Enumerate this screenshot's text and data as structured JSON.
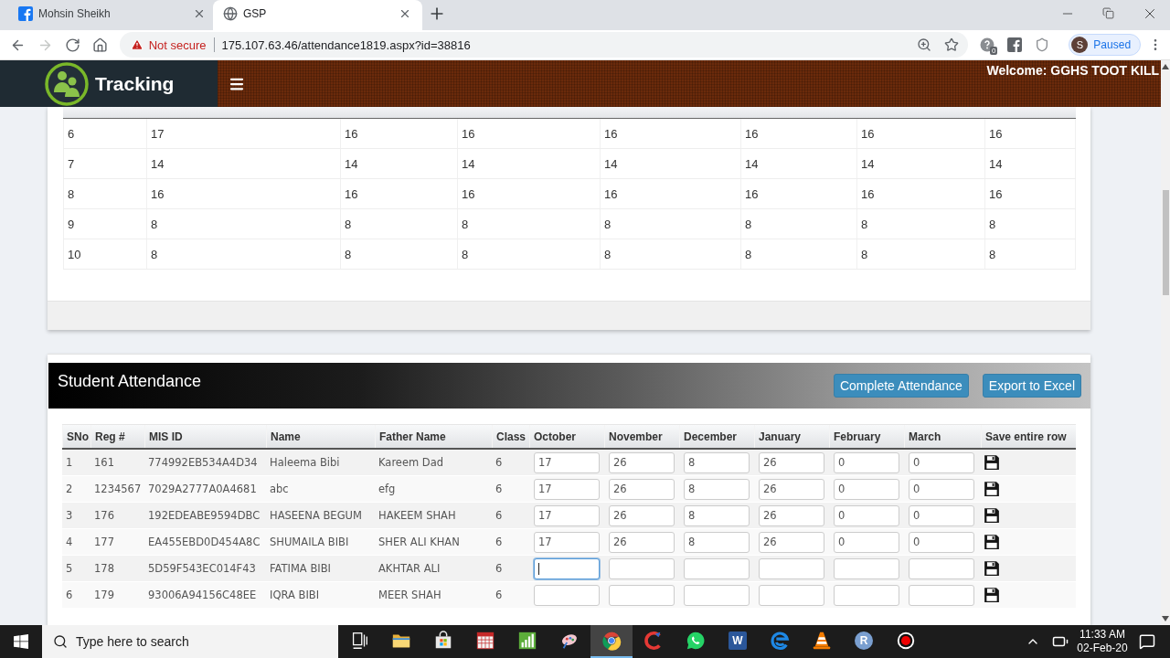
{
  "browser": {
    "tabs": [
      {
        "kind": "facebook",
        "title": "Mohsin Sheikh",
        "selected": false
      },
      {
        "kind": "globe",
        "title": "GSP",
        "selected": true
      }
    ],
    "nav": [
      {
        "kind": "back",
        "disabled": false
      },
      {
        "kind": "forward",
        "disabled": true
      },
      {
        "kind": "reload",
        "disabled": false
      },
      {
        "kind": "home",
        "disabled": false
      }
    ],
    "address_bar": {
      "security": "Not secure",
      "url": "175.107.63.46/attendance1819.aspx?id=38816"
    },
    "extensions": [
      {
        "kind": "badge",
        "badge": "0"
      },
      {
        "kind": "facebook"
      },
      {
        "kind": "shield"
      }
    ],
    "profile": {
      "initial": "S",
      "status": "Paused"
    }
  },
  "app_header": {
    "brand": "Tracking",
    "welcome": "Welcome: GGHS TOOT KILL"
  },
  "class_summary": {
    "rows": [
      [
        "6",
        "17",
        "16",
        "16",
        "16",
        "16",
        "16",
        "16"
      ],
      [
        "7",
        "14",
        "14",
        "14",
        "14",
        "14",
        "14",
        "14"
      ],
      [
        "8",
        "16",
        "16",
        "16",
        "16",
        "16",
        "16",
        "16"
      ],
      [
        "9",
        "8",
        "8",
        "8",
        "8",
        "8",
        "8",
        "8"
      ],
      [
        "10",
        "8",
        "8",
        "8",
        "8",
        "8",
        "8",
        "8"
      ]
    ]
  },
  "student_attendance": {
    "title": "Student Attendance",
    "buttons": [
      "Complete Attendance",
      "Export to Excel"
    ],
    "columns": [
      "SNo",
      "Reg #",
      "MIS ID",
      "Name",
      "Father Name",
      "Class",
      "October",
      "November",
      "December",
      "January",
      "February",
      "March",
      "Save entire row"
    ],
    "rows": [
      {
        "sno": "1",
        "reg": "161",
        "mis_id": "774992EB534A4D34",
        "name": "Haleema Bibi",
        "father_name": "Kareem Dad",
        "class": "6",
        "months": [
          {
            "value": "17",
            "focused": false
          },
          {
            "value": "26",
            "focused": false
          },
          {
            "value": "8",
            "focused": false
          },
          {
            "value": "26",
            "focused": false
          },
          {
            "value": "0",
            "focused": false
          },
          {
            "value": "0",
            "focused": false
          }
        ]
      },
      {
        "sno": "2",
        "reg": "1234567",
        "mis_id": "7029A2777A0A4681",
        "name": "abc",
        "father_name": "efg",
        "class": "6",
        "months": [
          {
            "value": "17",
            "focused": false
          },
          {
            "value": "26",
            "focused": false
          },
          {
            "value": "8",
            "focused": false
          },
          {
            "value": "26",
            "focused": false
          },
          {
            "value": "0",
            "focused": false
          },
          {
            "value": "0",
            "focused": false
          }
        ]
      },
      {
        "sno": "3",
        "reg": "176",
        "mis_id": "192EDEABE9594DBC",
        "name": "HASEENA BEGUM",
        "father_name": "HAKEEM SHAH",
        "class": "6",
        "months": [
          {
            "value": "17",
            "focused": false
          },
          {
            "value": "26",
            "focused": false
          },
          {
            "value": "8",
            "focused": false
          },
          {
            "value": "26",
            "focused": false
          },
          {
            "value": "0",
            "focused": false
          },
          {
            "value": "0",
            "focused": false
          }
        ]
      },
      {
        "sno": "4",
        "reg": "177",
        "mis_id": "EA455EBD0D454A8C",
        "name": "SHUMAILA BIBI",
        "father_name": "SHER ALI KHAN",
        "class": "6",
        "months": [
          {
            "value": "17",
            "focused": false
          },
          {
            "value": "26",
            "focused": false
          },
          {
            "value": "8",
            "focused": false
          },
          {
            "value": "26",
            "focused": false
          },
          {
            "value": "0",
            "focused": false
          },
          {
            "value": "0",
            "focused": false
          }
        ]
      },
      {
        "sno": "5",
        "reg": "178",
        "mis_id": "5D59F543EC014F43",
        "name": "FATIMA BIBI",
        "father_name": "AKHTAR ALI",
        "class": "6",
        "months": [
          {
            "focused": true
          },
          {
            "focused": false
          },
          {
            "focused": false
          },
          {
            "focused": false
          },
          {
            "focused": false
          },
          {
            "focused": false
          }
        ]
      },
      {
        "sno": "6",
        "reg": "179",
        "mis_id": "93006A94156C48EE",
        "name": "IQRA BIBI",
        "father_name": "MEER SHAH",
        "class": "6",
        "months": [
          {
            "focused": false
          },
          {
            "focused": false
          },
          {
            "focused": false
          },
          {
            "focused": false
          },
          {
            "focused": false
          },
          {
            "focused": false
          }
        ]
      }
    ]
  },
  "taskbar": {
    "search_placeholder": "Type here to search",
    "apps": [
      {
        "kind": "task-view",
        "selected": false
      },
      {
        "kind": "folder",
        "selected": false
      },
      {
        "kind": "store",
        "selected": false
      },
      {
        "kind": "grid-tile",
        "selected": false
      },
      {
        "kind": "bar-chart",
        "selected": false
      },
      {
        "kind": "palette",
        "selected": false
      },
      {
        "kind": "chrome",
        "selected": true
      },
      {
        "kind": "c-shape",
        "selected": false
      },
      {
        "kind": "chat",
        "selected": false
      },
      {
        "kind": "word",
        "glyph": "W",
        "selected": false
      },
      {
        "kind": "swirl",
        "selected": false
      },
      {
        "kind": "cone",
        "selected": false
      },
      {
        "kind": "letter-circle",
        "glyph": "R",
        "selected": false
      },
      {
        "kind": "record",
        "selected": false
      }
    ],
    "time": "11:33 AM",
    "date": "02-Feb-20"
  }
}
